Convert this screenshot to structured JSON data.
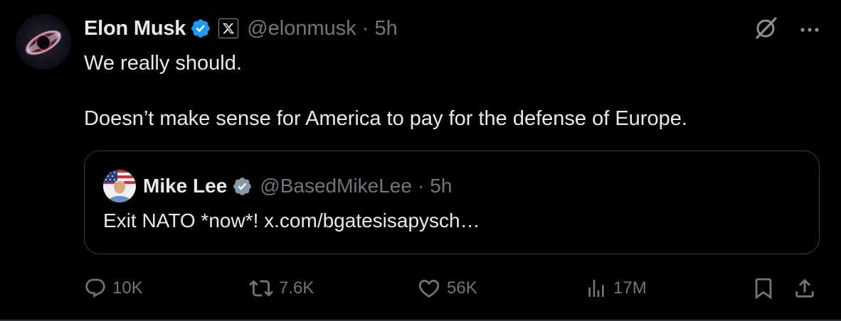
{
  "tweet": {
    "author": {
      "display_name": "Elon Musk",
      "handle": "@elonmusk",
      "verified_icon": "verified-badge-icon",
      "affiliate_icon": "x-logo-icon"
    },
    "separator": "·",
    "time": "5h",
    "top_icons": [
      "grok-icon",
      "more-icon"
    ],
    "more_label": "···",
    "text_lines": [
      "We really should.",
      "Doesn’t make sense for America to pay for the defense of Europe."
    ],
    "quote": {
      "display_name": "Mike Lee",
      "handle": "@BasedMikeLee",
      "separator": "·",
      "time": "5h",
      "text": "Exit NATO *now*! x.com/bgatesisapysch…"
    },
    "actions": {
      "replies": "10K",
      "reposts": "7.6K",
      "likes": "56K",
      "views": "17M"
    }
  },
  "colors": {
    "background": "#000000",
    "primary_text": "#e7e9ea",
    "secondary_text": "#71767b",
    "verified_blue": "#1d9bf0",
    "verified_gray": "#829aab",
    "border": "#3a3e42"
  }
}
